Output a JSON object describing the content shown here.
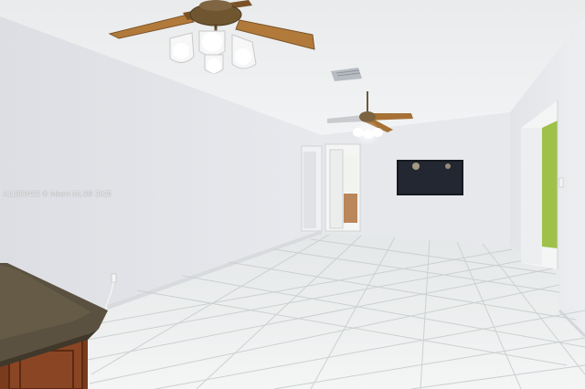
{
  "photo": {
    "subject": "empty living room with white tile floor and two ceiling fans",
    "watermark": "A11823422 © Miami MLS® 2025"
  },
  "colors": {
    "ceiling": "#eef0f1",
    "left_wall": "#e2e4e8",
    "back_wall": "#e6e8eb",
    "right_wall": "#e7e8eb",
    "floor": "#eef0f0",
    "grout": "#c9cccd",
    "fan_blade": "#b27a3a",
    "countertop": "#5b5140",
    "cabinet": "#7a3b1c",
    "green_room": "#9fc14a",
    "tv": "#16191f"
  },
  "icons": [
    "ceiling-fan-icon",
    "air-vent-icon",
    "wall-tv-icon",
    "doorway-icon",
    "electrical-outlet-icon"
  ]
}
